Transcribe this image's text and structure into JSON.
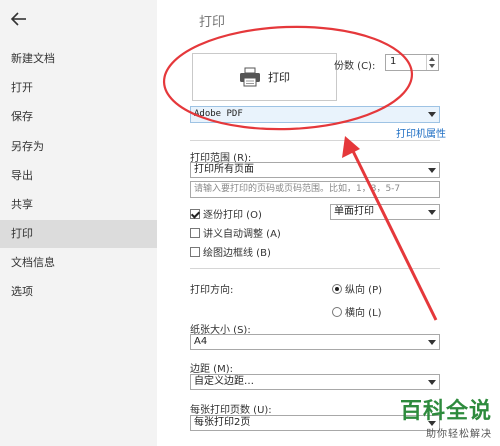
{
  "sidebar": {
    "items": [
      {
        "label": "新建文档"
      },
      {
        "label": "打开"
      },
      {
        "label": "保存"
      },
      {
        "label": "另存为"
      },
      {
        "label": "导出"
      },
      {
        "label": "共享"
      },
      {
        "label": "打印",
        "active": true
      },
      {
        "label": "文档信息"
      },
      {
        "label": "选项"
      }
    ]
  },
  "header": {
    "title": "打印"
  },
  "print": {
    "button_label": "打印",
    "copies_label": "份数 (C):",
    "copies_value": "1",
    "printer": "Adobe PDF",
    "printer_props": "打印机属性"
  },
  "range": {
    "label": "打印范围 (R):",
    "selected": "打印所有页面",
    "pages_placeholder": "请输入要打印的页码或页码范围。比如，1，3，5-7"
  },
  "options": {
    "collate_label": "逐份打印 (O)",
    "collate_checked": true,
    "duplex": "单面打印",
    "auto_adjust_label": "讲义自动调整 (A)",
    "auto_adjust_checked": false,
    "border_label": "绘图边框线 (B)",
    "border_checked": false
  },
  "orientation": {
    "label": "打印方向:",
    "portrait": "纵向 (P)",
    "landscape": "横向 (L)",
    "selected": "portrait"
  },
  "paper": {
    "label": "纸张大小 (S):",
    "value": "A4"
  },
  "margin": {
    "label": "边距 (M):",
    "value": "自定义边距…"
  },
  "pages_per_sheet": {
    "label": "每张打印页数 (U):",
    "value": "每张打印2页"
  },
  "watermark": {
    "line1": "百科全说",
    "line2": "助你轻松解决"
  },
  "colors": {
    "annotation": "#e5383b",
    "link": "#1f6fc4",
    "watermark": "#2e8b3d"
  }
}
